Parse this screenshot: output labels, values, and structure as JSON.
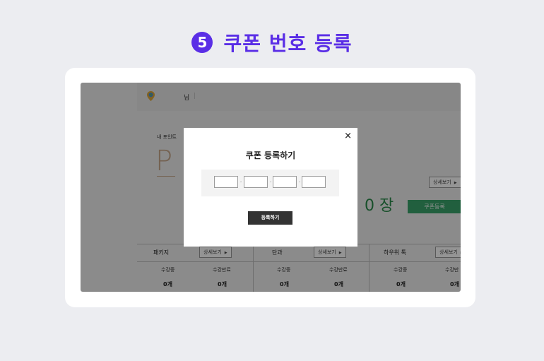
{
  "heading": {
    "step": "5",
    "title": "쿠폰 번호 등록"
  },
  "screen": {
    "header": {
      "greeting": "님",
      "separator": "|"
    },
    "mypoint": {
      "label": "내 포인트",
      "value": "P"
    },
    "detail_label": "상세보기",
    "coupon_count": "0 장",
    "coupon_register_button": "쿠폰등록",
    "categories": [
      {
        "name": "패키지",
        "active_label": "수강중",
        "active_count": "0개",
        "done_label": "수강만료",
        "done_count": "0개"
      },
      {
        "name": "단과",
        "active_label": "수강중",
        "active_count": "0개",
        "done_label": "수강만료",
        "done_count": "0개"
      },
      {
        "name": "하우위 톡",
        "active_label": "수강중",
        "active_count": "0개",
        "done_label": "수강만",
        "done_count": "0개"
      }
    ]
  },
  "modal": {
    "title": "쿠폰 등록하기",
    "close": "×",
    "dash": "-",
    "submit": "등록하기"
  },
  "colors": {
    "accent": "#5a2ee6",
    "green": "#3aa46c"
  }
}
